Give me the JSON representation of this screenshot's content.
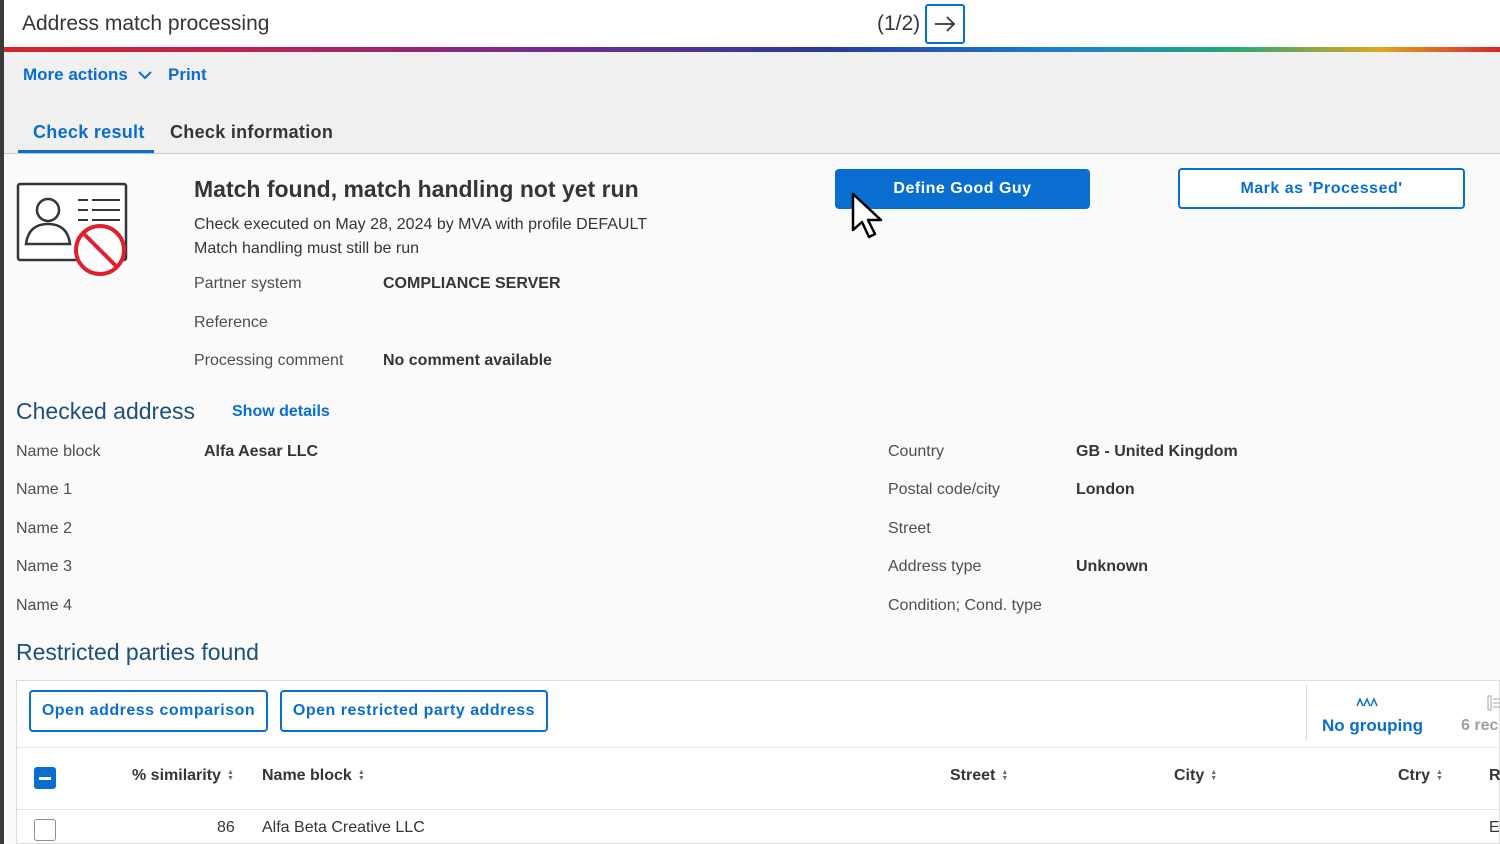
{
  "header": {
    "title": "Address match processing",
    "pager": "(1/2)"
  },
  "toolbar": {
    "more_actions": "More actions",
    "print": "Print"
  },
  "tabs": [
    {
      "label": "Check result",
      "active": true
    },
    {
      "label": "Check information",
      "active": false
    }
  ],
  "result": {
    "headline": "Match found, match handling not yet run",
    "executed": "Check executed on May 28, 2024 by MVA with profile DEFAULT",
    "handling": "Match handling must still be run",
    "fields": [
      {
        "label": "Partner system",
        "value": "COMPLIANCE SERVER"
      },
      {
        "label": "Reference",
        "value": ""
      },
      {
        "label": "Processing comment",
        "value": "No comment available"
      }
    ],
    "define_good_guy": "Define Good Guy",
    "mark_processed": "Mark as 'Processed'"
  },
  "checked_address": {
    "title": "Checked address",
    "show_details": "Show details",
    "left": [
      {
        "label": "Name block",
        "value": "Alfa Aesar LLC"
      },
      {
        "label": "Name 1",
        "value": ""
      },
      {
        "label": "Name 2",
        "value": ""
      },
      {
        "label": "Name 3",
        "value": ""
      },
      {
        "label": "Name 4",
        "value": ""
      }
    ],
    "right": [
      {
        "label": "Country",
        "value": "GB - United Kingdom"
      },
      {
        "label": "Postal code/city",
        "value": "London"
      },
      {
        "label": "Street",
        "value": ""
      },
      {
        "label": "Address type",
        "value": "Unknown"
      },
      {
        "label": "Condition; Cond. type",
        "value": ""
      }
    ]
  },
  "restricted": {
    "title": "Restricted parties found",
    "open_comparison": "Open address comparison",
    "open_restricted": "Open restricted party address",
    "grouping": "No grouping",
    "records": "6 rec",
    "columns": {
      "similarity": "% similarity",
      "name_block": "Name block",
      "street": "Street",
      "city": "City",
      "ctry": "Ctry",
      "r": "R"
    },
    "rows": [
      {
        "similarity": "86",
        "name_block": "Alfa Beta Creative LLC",
        "street": "",
        "city": "",
        "ctry": "",
        "r": "E"
      }
    ]
  },
  "colors": {
    "accent": "#0a6ed1",
    "section_title": "#1d4f7c",
    "alert": "#e0202e"
  }
}
